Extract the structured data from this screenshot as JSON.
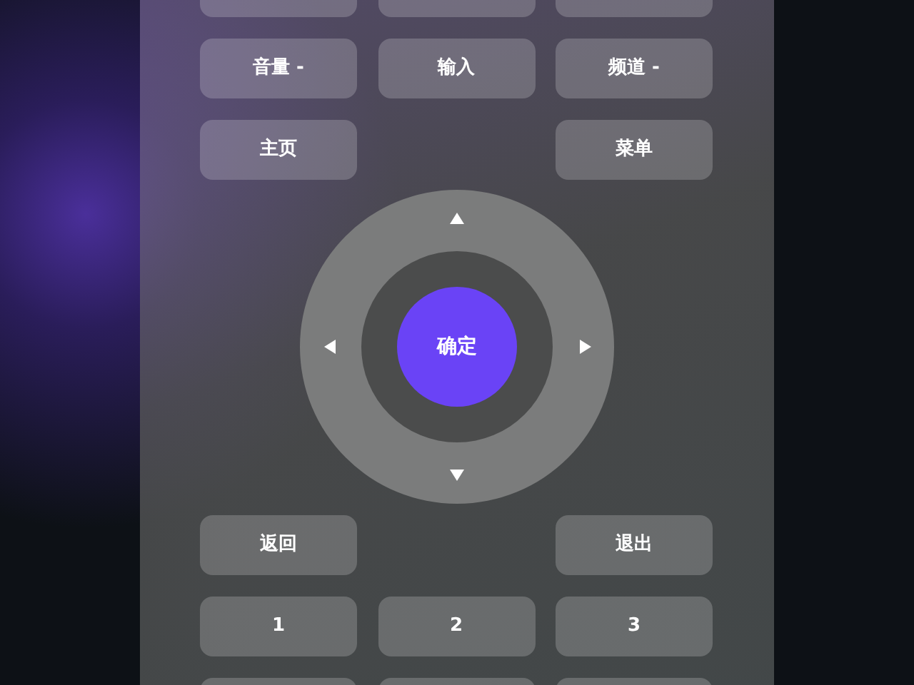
{
  "rows_top": [
    [
      {
        "kind": "cut"
      },
      {
        "kind": "cut"
      },
      {
        "kind": "cut"
      }
    ],
    [
      {
        "kind": "button",
        "label": "音量 -"
      },
      {
        "kind": "button",
        "label": "输入"
      },
      {
        "kind": "button",
        "label": "频道 -"
      }
    ],
    [
      {
        "kind": "button",
        "label": "主页"
      },
      {
        "kind": "gap"
      },
      {
        "kind": "button",
        "label": "菜单"
      }
    ]
  ],
  "dpad": {
    "center_label": "确定"
  },
  "rows_bottom": [
    [
      {
        "kind": "button",
        "label": "返回"
      },
      {
        "kind": "gap"
      },
      {
        "kind": "button",
        "label": "退出"
      }
    ],
    [
      {
        "kind": "button",
        "label": "1"
      },
      {
        "kind": "button",
        "label": "2"
      },
      {
        "kind": "button",
        "label": "3"
      }
    ],
    [
      {
        "kind": "cut"
      },
      {
        "kind": "cut"
      },
      {
        "kind": "cut"
      }
    ]
  ]
}
